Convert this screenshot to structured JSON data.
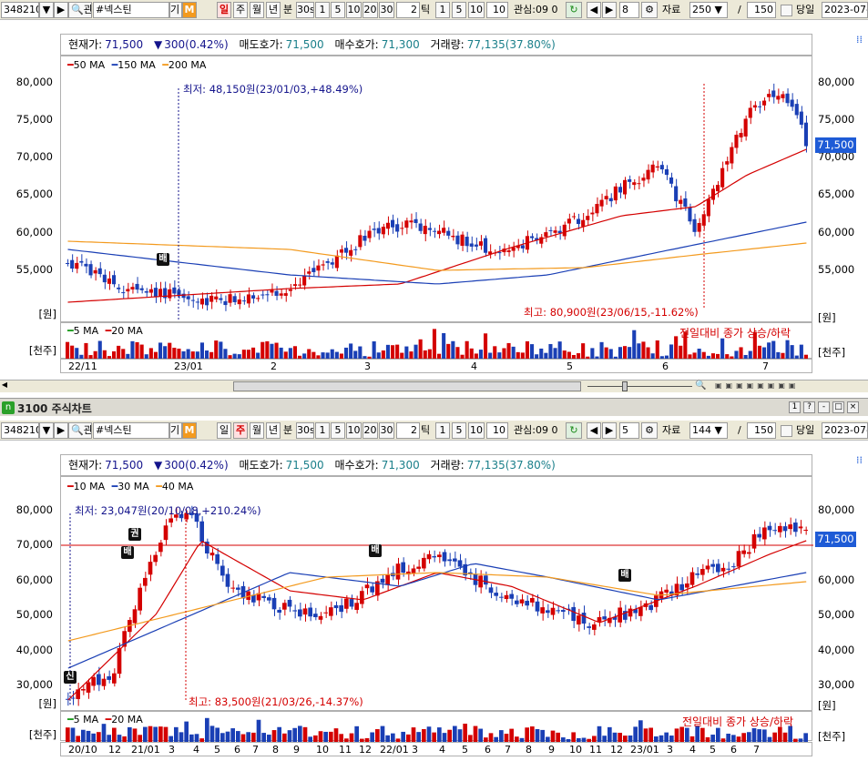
{
  "top": {
    "toolbar": {
      "code": "348210",
      "name": "#넥스틴",
      "period_tabs": [
        "일",
        "주",
        "월",
        "년"
      ],
      "active_tab": "일",
      "min_label": "분",
      "min_sel": "30s",
      "min_buttons": [
        "1",
        "5",
        "10",
        "20",
        "30"
      ],
      "tick_value": "2",
      "tick_label": "틱",
      "tick_buttons": [
        "1",
        "5",
        "10"
      ],
      "tick_input": "10",
      "interest_label": "관심:09",
      "interest_value": "0",
      "page_value": "8",
      "data_label": "자료",
      "data_value": "250",
      "slash": "/",
      "data_total": "150",
      "today_label": "당일",
      "date": "2023-07-",
      "gwan": "관",
      "gi": "기",
      "m": "M"
    },
    "info": {
      "current_label": "현재가:",
      "current_value": "71,500",
      "change_symbol": "▼",
      "change": "300(0.42%)",
      "ask_label": "매도호가:",
      "ask_value": "71,500",
      "bid_label": "매수호가:",
      "bid_value": "71,300",
      "volume_label": "거래량:",
      "volume_value": "77,135(37.80%)"
    },
    "legend": [
      "50 MA",
      "150 MA",
      "200 MA"
    ],
    "legend_colors": [
      "#d40000",
      "#1a3fb5",
      "#f39a1e"
    ],
    "y_ticks": [
      "80,000",
      "75,000",
      "70,000",
      "65,000",
      "60,000",
      "55,000"
    ],
    "y_unit": "[원]",
    "vol_unit": "[천주]",
    "current_price_box": "71,500",
    "low_annotation": "최저: 48,150원(23/01/03,+48.49%)",
    "high_annotation": "최고: 80,900원(23/06/15,-11.62%)",
    "marker": "배",
    "vol_legend": [
      "5 MA",
      "20 MA"
    ],
    "vol_legend_colors": [
      "#1a9a1a",
      "#d40000"
    ],
    "vol_note": "전일대비 종가 상승/하락",
    "x_ticks": [
      "22/11",
      "23/01",
      "2",
      "3",
      "4",
      "5",
      "6",
      "7"
    ]
  },
  "bottom": {
    "title": "3100 주식차트",
    "title_icon": "n",
    "toolbar": {
      "code": "348210",
      "name": "#넥스틴",
      "period_tabs": [
        "일",
        "주",
        "월",
        "년"
      ],
      "active_tab": "주",
      "min_label": "분",
      "min_sel": "30s",
      "min_buttons": [
        "1",
        "5",
        "10",
        "20",
        "30"
      ],
      "tick_value": "2",
      "tick_label": "틱",
      "tick_buttons": [
        "1",
        "5",
        "10"
      ],
      "tick_input": "10",
      "interest_label": "관심:09",
      "interest_value": "0",
      "page_value": "5",
      "data_label": "자료",
      "data_value": "144",
      "slash": "/",
      "data_total": "150",
      "today_label": "당일",
      "date": "2023-07-",
      "gwan": "관",
      "gi": "기",
      "m": "M"
    },
    "info": {
      "current_label": "현재가:",
      "current_value": "71,500",
      "change_symbol": "▼",
      "change": "300(0.42%)",
      "ask_label": "매도호가:",
      "ask_value": "71,500",
      "bid_label": "매수호가:",
      "bid_value": "71,300",
      "volume_label": "거래량:",
      "volume_value": "77,135(37.80%)"
    },
    "legend": [
      "10 MA",
      "30 MA",
      "40 MA"
    ],
    "legend_colors": [
      "#d40000",
      "#1a3fb5",
      "#f39a1e"
    ],
    "y_ticks": [
      "80,000",
      "70,000",
      "60,000",
      "50,000",
      "40,000",
      "30,000"
    ],
    "y_unit": "[원]",
    "vol_unit": "[천주]",
    "current_price_box": "71,500",
    "low_annotation": "최저: 23,047원(20/10/08,+210.24%)",
    "high_annotation": "최고: 83,500원(21/03/26,-14.37%)",
    "markers": [
      "신",
      "배",
      "권",
      "배",
      "배"
    ],
    "vol_legend": [
      "5 MA",
      "20 MA"
    ],
    "vol_legend_colors": [
      "#1a9a1a",
      "#d40000"
    ],
    "vol_note": "전일대비 종가 상승/하락",
    "x_ticks": [
      "20/10",
      "12",
      "21/01",
      "3",
      "4",
      "5",
      "6",
      "7",
      "8",
      "9",
      "10",
      "11",
      "12",
      "22/01",
      "3",
      "4",
      "5",
      "6",
      "7",
      "8",
      "9",
      "10",
      "11",
      "12",
      "23/01",
      "3",
      "4",
      "5",
      "6",
      "7"
    ],
    "title_buttons": [
      "1",
      "?",
      "-",
      "□",
      "×"
    ]
  },
  "colors": {
    "up": "#d40000",
    "down": "#1a3fb5",
    "accent": "#1e5bd6"
  }
}
